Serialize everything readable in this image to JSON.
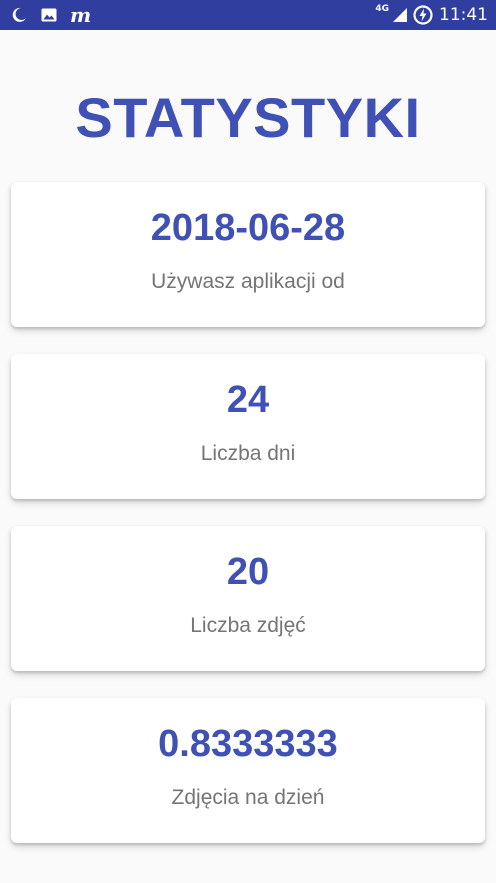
{
  "status_bar": {
    "network": "4G",
    "time": "11:41",
    "app_glyph": "m",
    "icons": [
      "moon-icon",
      "image-icon",
      "m-icon",
      "signal-icon",
      "battery-charging-icon"
    ]
  },
  "page": {
    "title": "STATYSTYKI"
  },
  "stats": [
    {
      "value": "2018-06-28",
      "label": "Używasz aplikacji od"
    },
    {
      "value": "24",
      "label": "Liczba dni"
    },
    {
      "value": "20",
      "label": "Liczba zdjęć"
    },
    {
      "value": "0.8333333",
      "label": "Zdjęcia na dzień"
    }
  ],
  "colors": {
    "status_bar": "#303f9f",
    "accent": "#3f51b5",
    "label": "#757575",
    "background": "#fafafa",
    "card": "#ffffff"
  }
}
